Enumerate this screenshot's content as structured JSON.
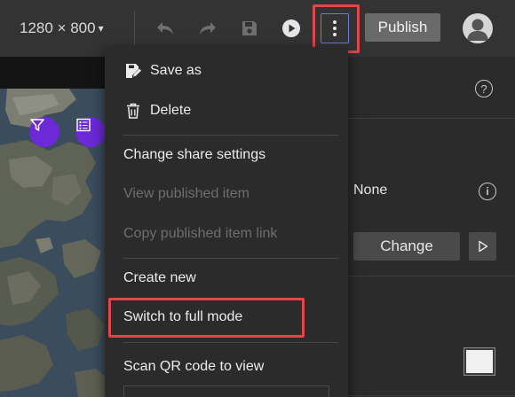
{
  "toolbar": {
    "screen_size": "1280 × 800",
    "caret": "▾",
    "publish_label": "Publish",
    "icons": [
      "undo-icon",
      "redo-icon",
      "save-icon",
      "preview-play-icon",
      "more-options-icon",
      "avatar-icon"
    ]
  },
  "map": {
    "buttons": [
      "filter-icon",
      "legend-icon"
    ],
    "accent_color": "#6b29d8"
  },
  "panel": {
    "none_text": "None",
    "help_glyph": "?",
    "info_glyph": "i",
    "change_label": "Change"
  },
  "menu": {
    "items": [
      {
        "label": "Save as",
        "icon": "save-as-icon",
        "enabled": true
      },
      {
        "label": "Delete",
        "icon": "trash-icon",
        "enabled": true
      },
      {
        "label": "Change share settings",
        "enabled": true
      },
      {
        "label": "View published item",
        "enabled": false
      },
      {
        "label": "Copy published item link",
        "enabled": false
      },
      {
        "label": "Create new",
        "enabled": true
      },
      {
        "label": "Switch to full mode",
        "enabled": true
      },
      {
        "label": "Scan QR code to view",
        "enabled": true
      }
    ]
  },
  "highlight_color": "#e0474c"
}
